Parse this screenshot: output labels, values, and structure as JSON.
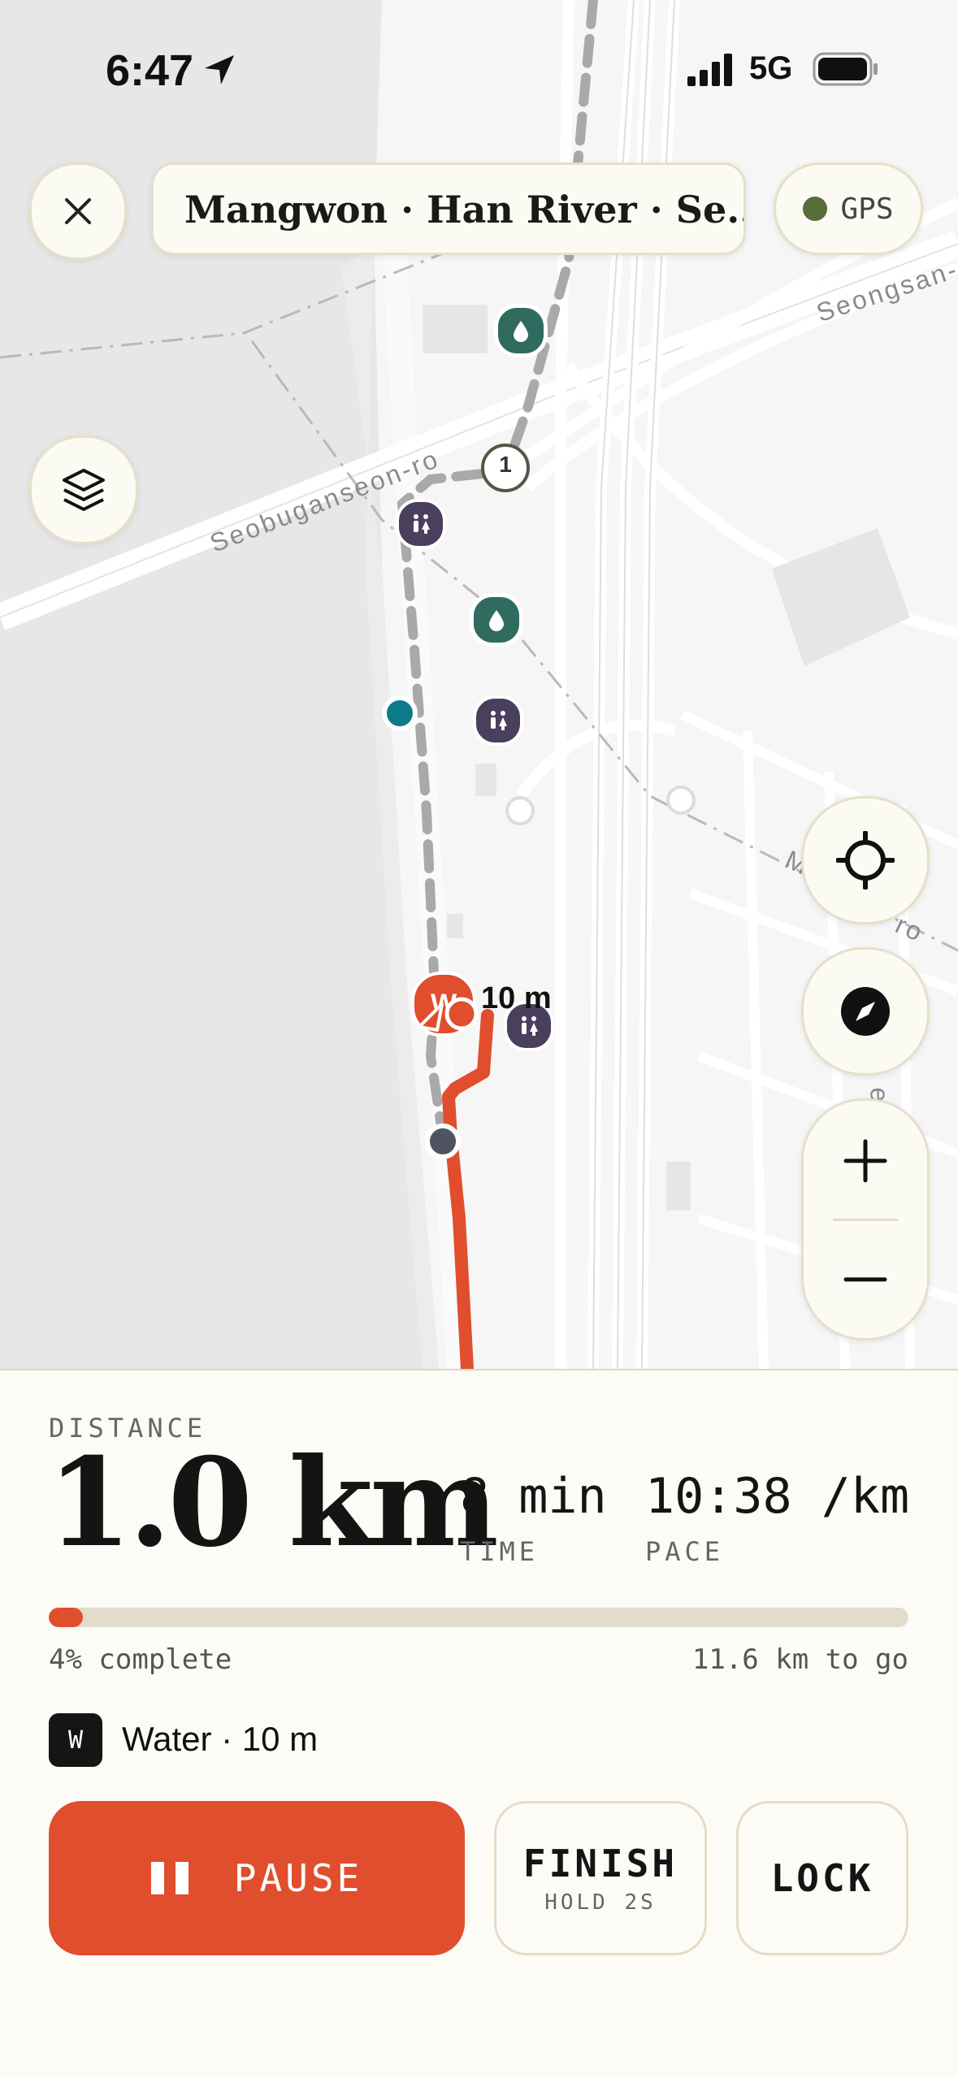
{
  "status_bar": {
    "time": "6:47",
    "network": "5G"
  },
  "header": {
    "route_title": "Mangwon · Han River · Se...",
    "gps_label": "GPS"
  },
  "map": {
    "road_labels": [
      "Seobuganseon-ro",
      "Seongsan-",
      "M",
      "ro",
      "eon"
    ],
    "waypoint_number": "1",
    "waypoint_letter": "W",
    "waypoint_distance": "10 m"
  },
  "panel": {
    "distance_label": "DISTANCE",
    "distance_value": "1.0 km",
    "time_value": "8 min",
    "time_label": "TIME",
    "pace_value": "10:38 /km",
    "pace_label": "PACE",
    "progress_percent": 4,
    "progress_text": "4% complete",
    "remaining_text": "11.6 km to go",
    "next_waypoint_badge": "W",
    "next_waypoint_text": "Water · 10 m",
    "pause_label": "PAUSE",
    "finish_label": "FINISH",
    "finish_sub": "HOLD 2S",
    "lock_label": "LOCK"
  },
  "colors": {
    "accent": "#e04e2d",
    "water_marker": "#2f6b5e",
    "restroom_marker": "#4a3f5c",
    "gps_dot": "#5a6b3c",
    "panel_bg": "#fcfbf6"
  }
}
